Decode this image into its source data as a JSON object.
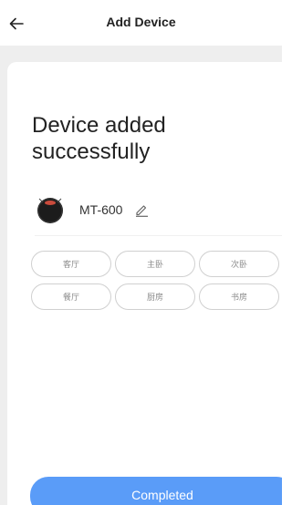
{
  "header": {
    "title": "Add Device",
    "back_icon": "arrow-left-icon"
  },
  "main": {
    "success_message": "Device added successfully",
    "device": {
      "name": "MT-600",
      "icon": "robot-vacuum-icon",
      "edit_icon": "pencil-icon"
    },
    "rooms": [
      "客厅",
      "主卧",
      "次卧",
      "餐厅",
      "厨房",
      "书房"
    ]
  },
  "footer": {
    "completed_label": "Completed"
  },
  "colors": {
    "accent": "#5a9cf8",
    "background_band": "#eeeeee",
    "chip_border": "#d0d0d0",
    "chip_text": "#8a8a8a"
  }
}
